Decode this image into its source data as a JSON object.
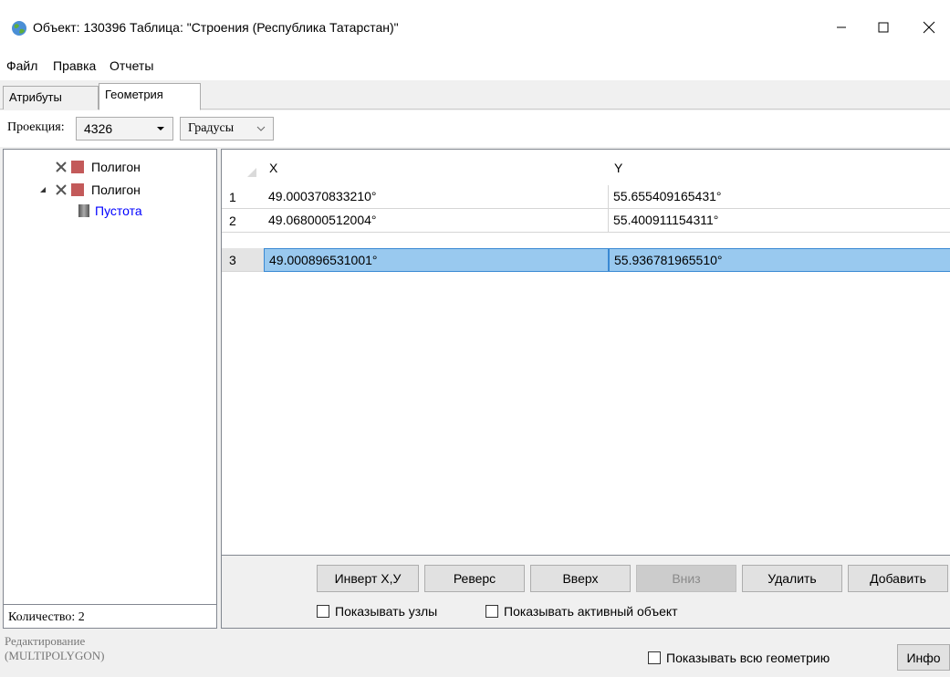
{
  "window": {
    "title": "Объект: 130396 Таблица: \"Строения (Республика Татарстан)\""
  },
  "menu": [
    "Файл",
    "Правка",
    "Отчеты"
  ],
  "tabs": [
    {
      "label": "Атрибуты",
      "active": false
    },
    {
      "label": "Геометрия",
      "active": true
    }
  ],
  "toolbar": {
    "projection_label": "Проекция:",
    "projection_value": "4326",
    "units_value": "Градусы"
  },
  "tree": [
    {
      "label": "Полигон",
      "level": 0,
      "expanded": false
    },
    {
      "label": "Полигон",
      "level": 0,
      "expanded": true
    },
    {
      "label": "Пустота",
      "level": 1,
      "selected": true
    }
  ],
  "count_text": "Количество: 2",
  "grid": {
    "columns": [
      "X",
      "Y"
    ],
    "rows": [
      {
        "num": "1",
        "x": "49.000370833210°",
        "y": "55.655409165431°"
      },
      {
        "num": "2",
        "x": "49.068000512004°",
        "y": "55.400911154311°"
      },
      {
        "num": "3",
        "x": "49.000896531001°",
        "y": "55.936781965510°",
        "selected": true
      }
    ]
  },
  "buttons": {
    "invert": "Инверт Х,У",
    "reverse": "Реверс",
    "up": "Вверх",
    "down": "Вниз",
    "delete": "Удалить",
    "add": "Добавить"
  },
  "checkboxes": {
    "show_nodes": "Показывать узлы",
    "show_active": "Показывать активный объект",
    "show_all_geometry": "Показывать всю геометрию"
  },
  "status": {
    "line1": "Редактирование",
    "line2": "(MULTIPOLYGON)"
  },
  "info_button": "Инфо",
  "colors": {
    "selection": "#99c9ef",
    "selection_border": "#3a89d3",
    "tree_selected_text": "#0000ff"
  }
}
